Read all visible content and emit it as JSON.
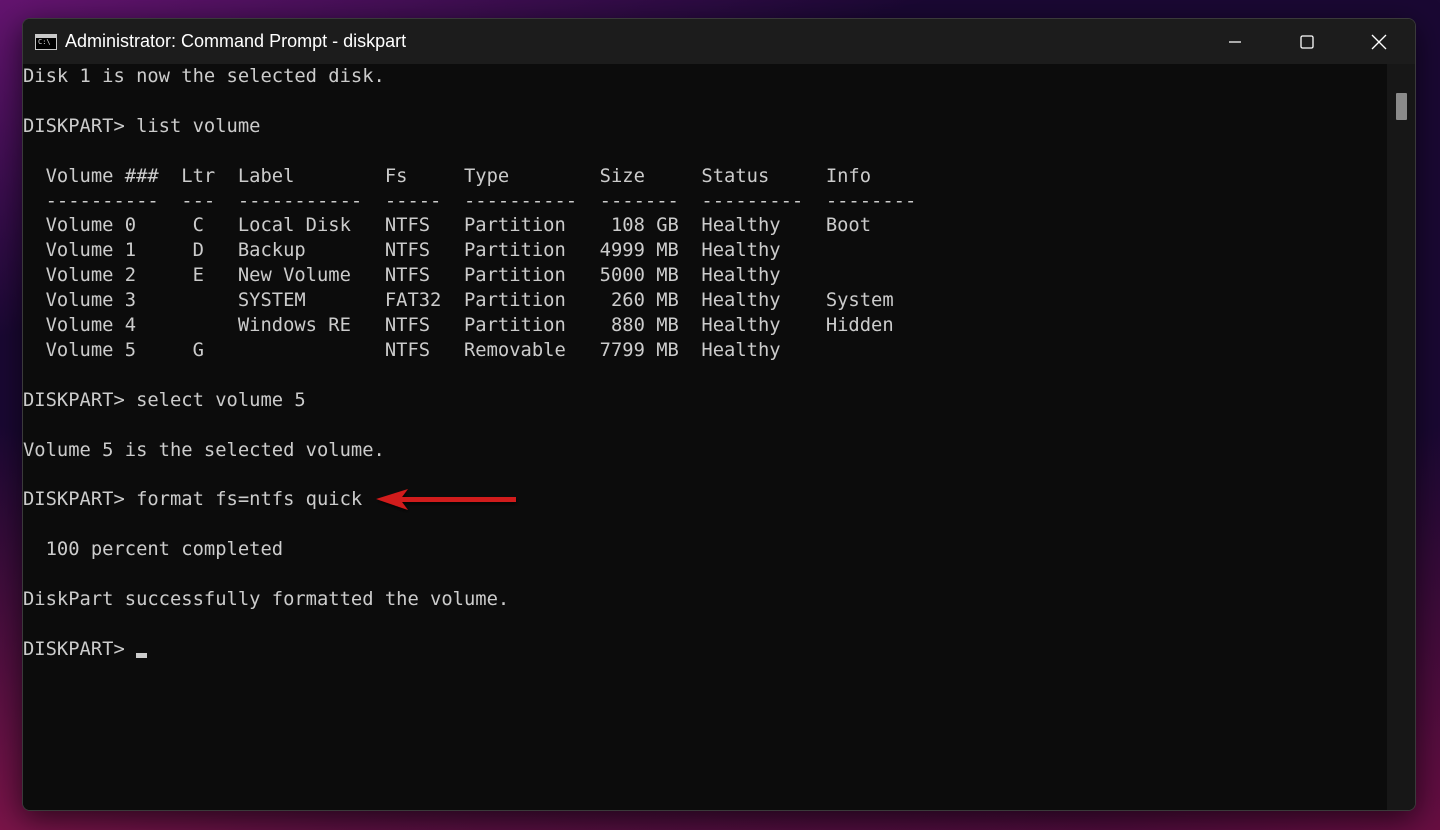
{
  "window": {
    "title": "Administrator: Command Prompt - diskpart",
    "app_icon": "cmd-icon",
    "controls": [
      "minimize-icon",
      "maximize-icon",
      "close-icon"
    ]
  },
  "console": {
    "lines": [
      "Disk 1 is now the selected disk.",
      "",
      "DISKPART> list volume",
      "",
      "  Volume ###  Ltr  Label        Fs     Type        Size     Status     Info",
      "  ----------  ---  -----------  -----  ----------  -------  ---------  --------",
      "  Volume 0     C   Local Disk   NTFS   Partition    108 GB  Healthy    Boot",
      "  Volume 1     D   Backup       NTFS   Partition   4999 MB  Healthy",
      "  Volume 2     E   New Volume   NTFS   Partition   5000 MB  Healthy",
      "  Volume 3         SYSTEM       FAT32  Partition    260 MB  Healthy    System",
      "  Volume 4         Windows RE   NTFS   Partition    880 MB  Healthy    Hidden",
      "  Volume 5     G                NTFS   Removable   7799 MB  Healthy",
      "",
      "DISKPART> select volume 5",
      "",
      "Volume 5 is the selected volume.",
      "",
      "DISKPART> format fs=ntfs quick",
      "",
      "  100 percent completed",
      "",
      "DiskPart successfully formatted the volume.",
      "",
      "DISKPART> "
    ],
    "text_color": "#cccccc",
    "background": "#0c0c0c"
  },
  "annotation": {
    "icon": "red-arrow-icon",
    "color": "#d11a1a"
  }
}
